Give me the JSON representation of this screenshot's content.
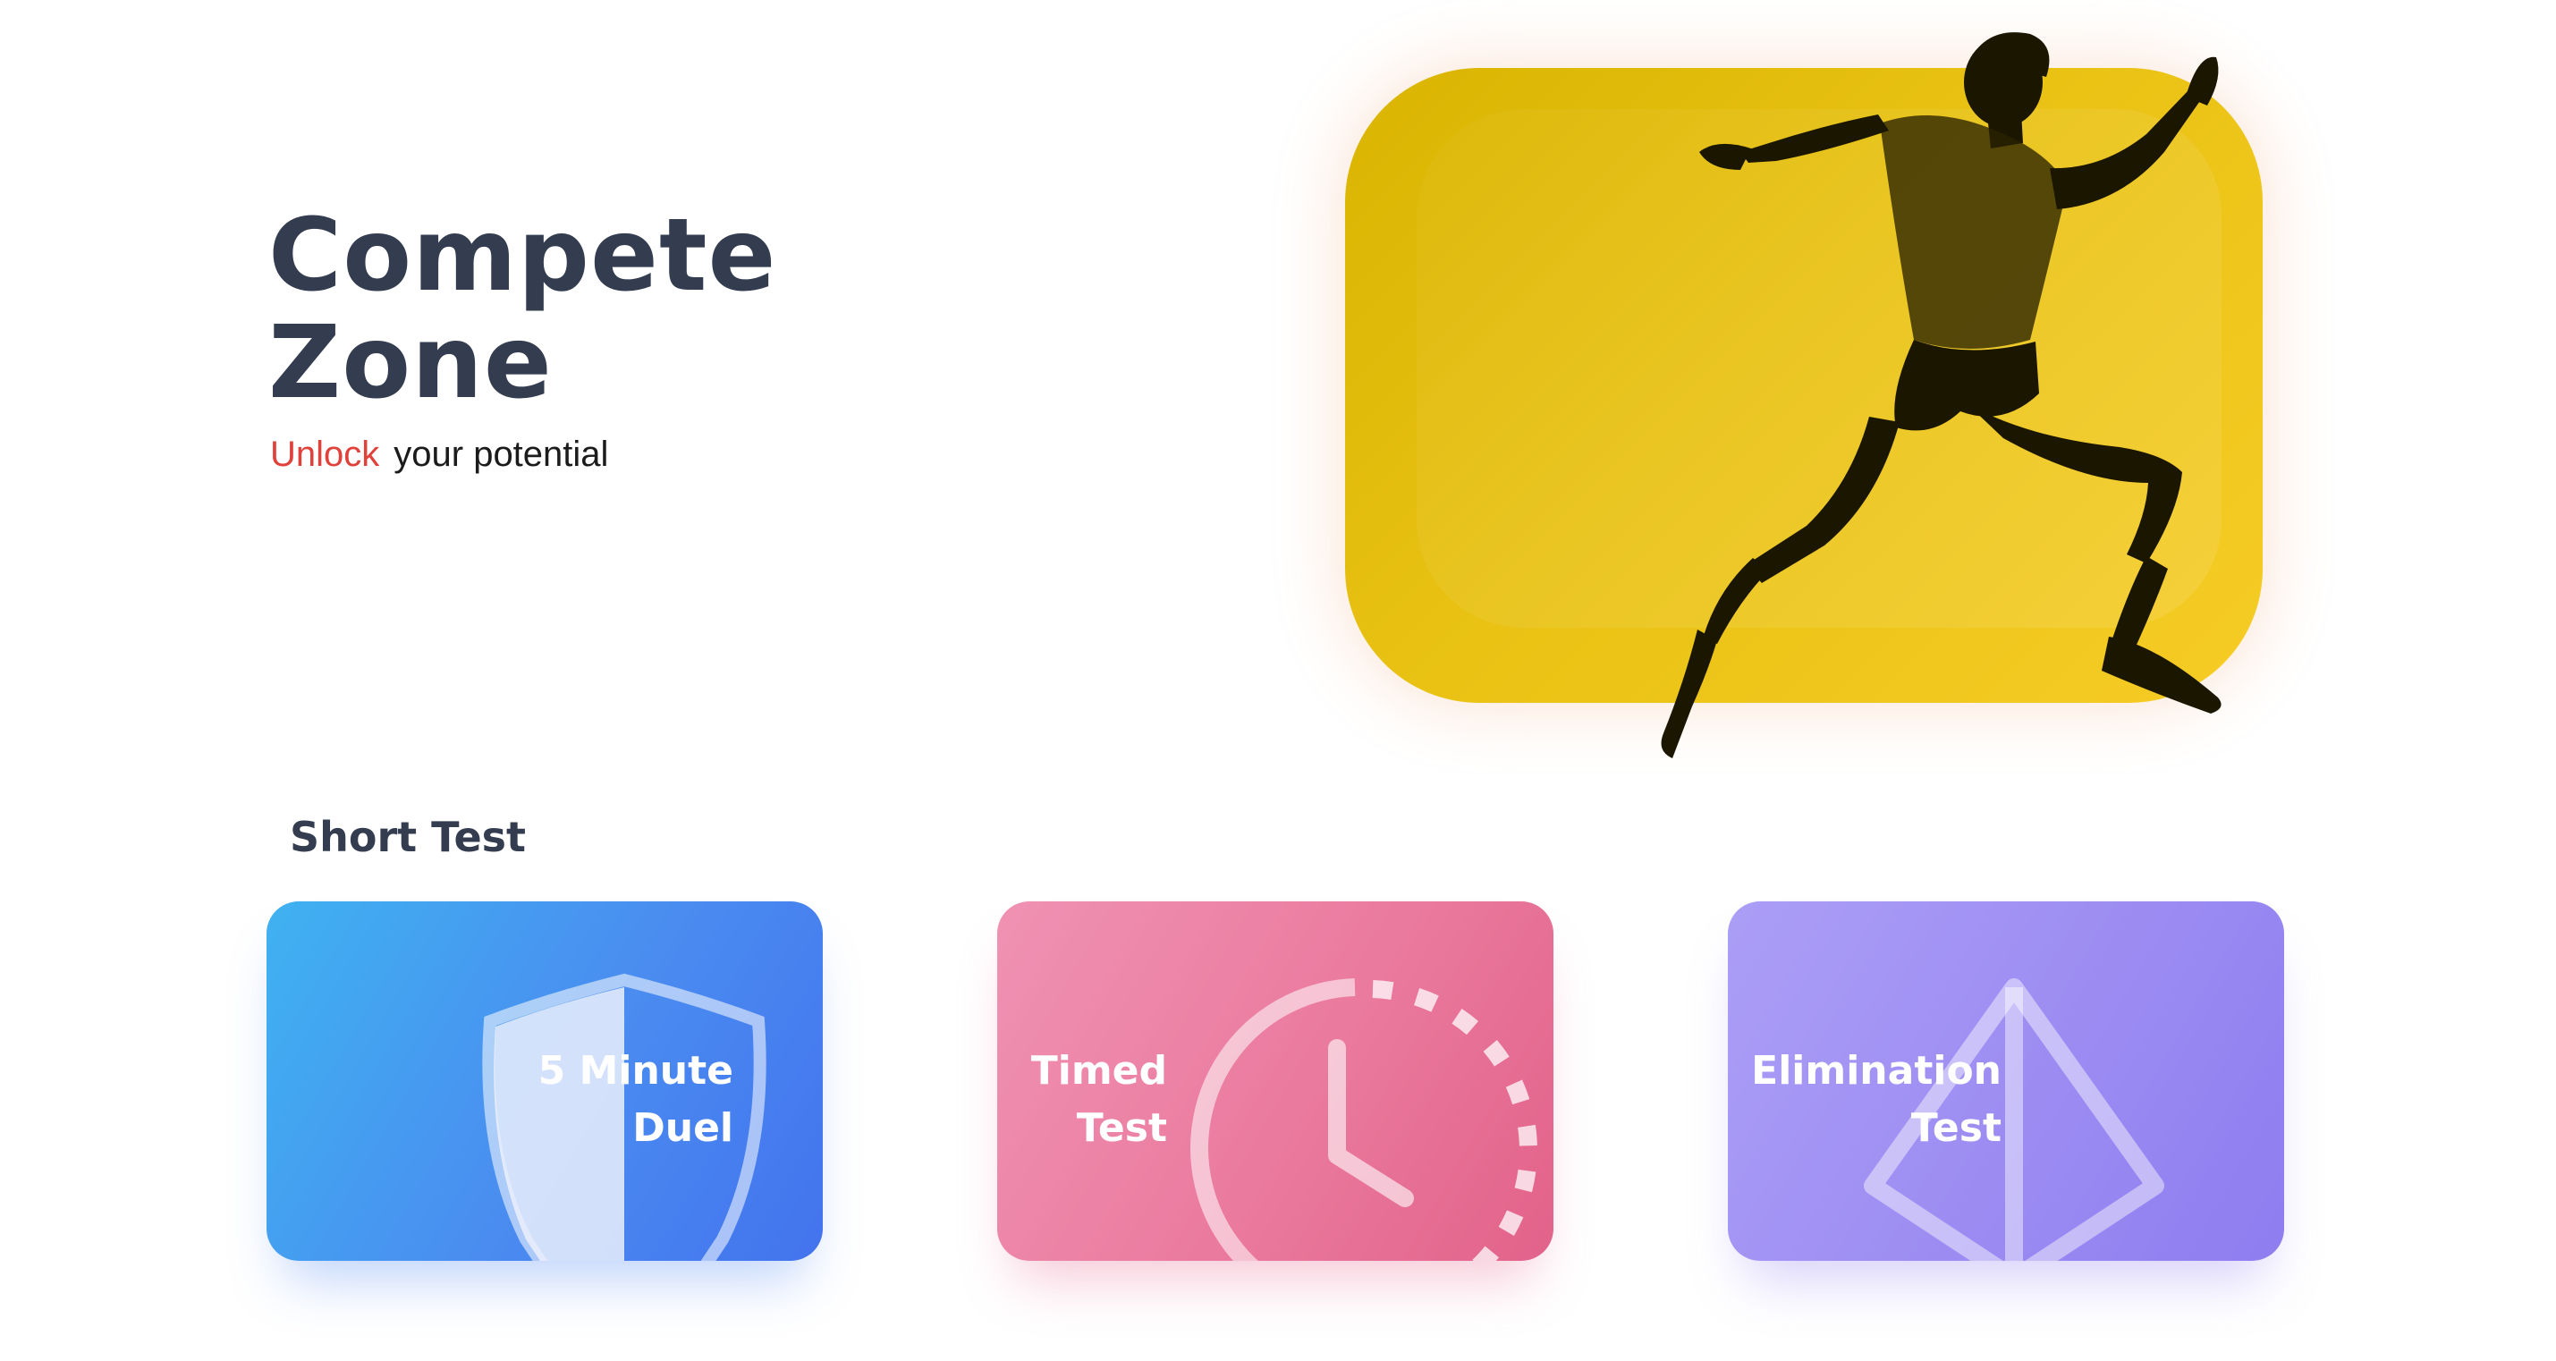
{
  "hero": {
    "title_line1": "Compete",
    "title_line2": "Zone",
    "tagline_accent": "Unlock",
    "tagline_rest": "your potential",
    "image": "runner-sprinting-image"
  },
  "short_test": {
    "heading": "Short Test",
    "cards": [
      {
        "line1": "5 Minute",
        "line2": "Duel",
        "icon": "shield-icon"
      },
      {
        "line1": "Timed",
        "line2": "Test",
        "icon": "clock-icon"
      },
      {
        "line1": "Elimination",
        "line2": "Test",
        "icon": "pyramid-icon"
      }
    ]
  },
  "colors": {
    "title": "#343c4f",
    "accent": "#e0413a",
    "hero_card": "#efc51b",
    "duel_card": "#4a8cf0",
    "timed_card": "#ea7a9e",
    "elimination_card": "#9c8cf2"
  }
}
